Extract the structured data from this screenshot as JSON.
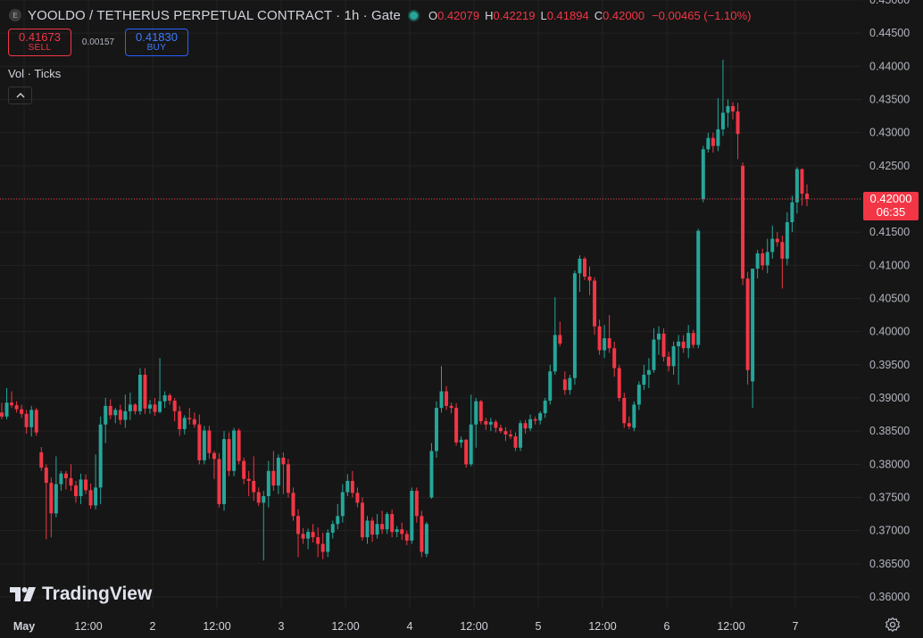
{
  "header": {
    "exchange_icon_letter": "E",
    "symbol_title": "YOOLDO / TETHERUS PERPETUAL CONTRACT · 1h · Gate",
    "open_label": "O",
    "open_value": "0.42079",
    "high_label": "H",
    "high_value": "0.42219",
    "low_label": "L",
    "low_value": "0.41894",
    "close_label": "C",
    "close_value": "0.42000",
    "change": "−0.00465 (−1.10%)"
  },
  "trade": {
    "sell_price": "0.41673",
    "sell_label": "SELL",
    "spread": "0.00157",
    "buy_price": "0.41830",
    "buy_label": "BUY"
  },
  "indicator": {
    "label": "Vol · Ticks",
    "collapse_glyph": "^"
  },
  "branding": {
    "logo_text": "TradingView"
  },
  "price_label": {
    "price": "0.42000",
    "countdown": "06:35"
  },
  "colors": {
    "up": "#26a69a",
    "down": "#f23645",
    "background": "#161616",
    "grid": "#232323"
  },
  "chart_data": {
    "type": "candlestick",
    "interval": "1h",
    "y_ticks": [
      "0.45000",
      "0.44500",
      "0.44000",
      "0.43500",
      "0.43000",
      "0.42500",
      "0.42000",
      "0.41500",
      "0.41000",
      "0.40500",
      "0.40000",
      "0.39500",
      "0.39000",
      "0.38500",
      "0.38000",
      "0.37500",
      "0.37000",
      "0.36500",
      "0.36000"
    ],
    "ylim": [
      0.3565,
      0.45
    ],
    "x_ticks": [
      "May",
      "12:00",
      "2",
      "12:00",
      "3",
      "12:00",
      "4",
      "12:00",
      "5",
      "12:00",
      "6",
      "12:00",
      "7"
    ],
    "last_price": 0.42,
    "grid": true,
    "candles": [
      {
        "o": 0.3878,
        "h": 0.3893,
        "l": 0.3868,
        "c": 0.3872
      },
      {
        "o": 0.3872,
        "h": 0.3915,
        "l": 0.3868,
        "c": 0.3893
      },
      {
        "o": 0.3893,
        "h": 0.391,
        "l": 0.3885,
        "c": 0.3889
      },
      {
        "o": 0.3889,
        "h": 0.3895,
        "l": 0.3878,
        "c": 0.3883
      },
      {
        "o": 0.3883,
        "h": 0.389,
        "l": 0.387,
        "c": 0.3876
      },
      {
        "o": 0.3876,
        "h": 0.3882,
        "l": 0.3846,
        "c": 0.3856
      },
      {
        "o": 0.3856,
        "h": 0.3888,
        "l": 0.3842,
        "c": 0.3882
      },
      {
        "o": 0.3882,
        "h": 0.3885,
        "l": 0.3843,
        "c": 0.3848
      },
      {
        "o": 0.3818,
        "h": 0.3826,
        "l": 0.379,
        "c": 0.3795
      },
      {
        "o": 0.3795,
        "h": 0.38,
        "l": 0.3687,
        "c": 0.3772
      },
      {
        "o": 0.3772,
        "h": 0.378,
        "l": 0.369,
        "c": 0.3726
      },
      {
        "o": 0.3726,
        "h": 0.3812,
        "l": 0.372,
        "c": 0.377
      },
      {
        "o": 0.377,
        "h": 0.379,
        "l": 0.376,
        "c": 0.3786
      },
      {
        "o": 0.3786,
        "h": 0.379,
        "l": 0.3762,
        "c": 0.3779
      },
      {
        "o": 0.3779,
        "h": 0.38,
        "l": 0.376,
        "c": 0.3768
      },
      {
        "o": 0.3768,
        "h": 0.3775,
        "l": 0.3742,
        "c": 0.3752
      },
      {
        "o": 0.3752,
        "h": 0.3786,
        "l": 0.374,
        "c": 0.3777
      },
      {
        "o": 0.3777,
        "h": 0.3785,
        "l": 0.3755,
        "c": 0.3761
      },
      {
        "o": 0.3761,
        "h": 0.3771,
        "l": 0.3733,
        "c": 0.3738
      },
      {
        "o": 0.3738,
        "h": 0.3815,
        "l": 0.3732,
        "c": 0.3765
      },
      {
        "o": 0.3765,
        "h": 0.3872,
        "l": 0.374,
        "c": 0.386
      },
      {
        "o": 0.386,
        "h": 0.39,
        "l": 0.3832,
        "c": 0.3888
      },
      {
        "o": 0.3888,
        "h": 0.3898,
        "l": 0.3868,
        "c": 0.3874
      },
      {
        "o": 0.3874,
        "h": 0.3885,
        "l": 0.3862,
        "c": 0.3882
      },
      {
        "o": 0.3882,
        "h": 0.389,
        "l": 0.386,
        "c": 0.3867
      },
      {
        "o": 0.3867,
        "h": 0.3905,
        "l": 0.3855,
        "c": 0.388
      },
      {
        "o": 0.388,
        "h": 0.3908,
        "l": 0.3867,
        "c": 0.389
      },
      {
        "o": 0.389,
        "h": 0.3892,
        "l": 0.3875,
        "c": 0.388
      },
      {
        "o": 0.388,
        "h": 0.3945,
        "l": 0.3875,
        "c": 0.3935
      },
      {
        "o": 0.3935,
        "h": 0.3945,
        "l": 0.3876,
        "c": 0.3884
      },
      {
        "o": 0.3884,
        "h": 0.3897,
        "l": 0.3876,
        "c": 0.389
      },
      {
        "o": 0.389,
        "h": 0.39,
        "l": 0.3873,
        "c": 0.3879
      },
      {
        "o": 0.3879,
        "h": 0.396,
        "l": 0.3877,
        "c": 0.3895
      },
      {
        "o": 0.3895,
        "h": 0.391,
        "l": 0.3885,
        "c": 0.3904
      },
      {
        "o": 0.3904,
        "h": 0.3907,
        "l": 0.389,
        "c": 0.3896
      },
      {
        "o": 0.3896,
        "h": 0.39,
        "l": 0.3865,
        "c": 0.388
      },
      {
        "o": 0.388,
        "h": 0.3888,
        "l": 0.3843,
        "c": 0.3853
      },
      {
        "o": 0.3853,
        "h": 0.3874,
        "l": 0.3845,
        "c": 0.387
      },
      {
        "o": 0.387,
        "h": 0.3885,
        "l": 0.386,
        "c": 0.3868
      },
      {
        "o": 0.3868,
        "h": 0.3878,
        "l": 0.3855,
        "c": 0.386
      },
      {
        "o": 0.386,
        "h": 0.3875,
        "l": 0.38,
        "c": 0.3806
      },
      {
        "o": 0.3806,
        "h": 0.3858,
        "l": 0.38,
        "c": 0.3851
      },
      {
        "o": 0.3851,
        "h": 0.3858,
        "l": 0.3808,
        "c": 0.3817
      },
      {
        "o": 0.3817,
        "h": 0.382,
        "l": 0.3778,
        "c": 0.3808
      },
      {
        "o": 0.3808,
        "h": 0.3817,
        "l": 0.3735,
        "c": 0.374
      },
      {
        "o": 0.374,
        "h": 0.385,
        "l": 0.373,
        "c": 0.3838
      },
      {
        "o": 0.3838,
        "h": 0.3848,
        "l": 0.3782,
        "c": 0.379
      },
      {
        "o": 0.379,
        "h": 0.3855,
        "l": 0.3782,
        "c": 0.3851
      },
      {
        "o": 0.3851,
        "h": 0.3854,
        "l": 0.38,
        "c": 0.3805
      },
      {
        "o": 0.3805,
        "h": 0.381,
        "l": 0.377,
        "c": 0.3778
      },
      {
        "o": 0.3778,
        "h": 0.379,
        "l": 0.3752,
        "c": 0.3775
      },
      {
        "o": 0.3775,
        "h": 0.3812,
        "l": 0.3745,
        "c": 0.3758
      },
      {
        "o": 0.3758,
        "h": 0.3765,
        "l": 0.3737,
        "c": 0.3742
      },
      {
        "o": 0.3742,
        "h": 0.376,
        "l": 0.3655,
        "c": 0.3752
      },
      {
        "o": 0.3752,
        "h": 0.3805,
        "l": 0.3735,
        "c": 0.379
      },
      {
        "o": 0.379,
        "h": 0.382,
        "l": 0.376,
        "c": 0.3768
      },
      {
        "o": 0.3768,
        "h": 0.3815,
        "l": 0.3755,
        "c": 0.381
      },
      {
        "o": 0.381,
        "h": 0.3818,
        "l": 0.3755,
        "c": 0.38
      },
      {
        "o": 0.38,
        "h": 0.3808,
        "l": 0.375,
        "c": 0.3757
      },
      {
        "o": 0.3757,
        "h": 0.3765,
        "l": 0.3715,
        "c": 0.3722
      },
      {
        "o": 0.3722,
        "h": 0.3732,
        "l": 0.366,
        "c": 0.3695
      },
      {
        "o": 0.3695,
        "h": 0.3704,
        "l": 0.368,
        "c": 0.3688
      },
      {
        "o": 0.3688,
        "h": 0.3703,
        "l": 0.3672,
        "c": 0.3698
      },
      {
        "o": 0.3698,
        "h": 0.371,
        "l": 0.3682,
        "c": 0.369
      },
      {
        "o": 0.369,
        "h": 0.3705,
        "l": 0.366,
        "c": 0.368
      },
      {
        "o": 0.368,
        "h": 0.3697,
        "l": 0.3657,
        "c": 0.3668
      },
      {
        "o": 0.3668,
        "h": 0.3702,
        "l": 0.366,
        "c": 0.3697
      },
      {
        "o": 0.3697,
        "h": 0.3715,
        "l": 0.3688,
        "c": 0.371
      },
      {
        "o": 0.371,
        "h": 0.374,
        "l": 0.3702,
        "c": 0.3722
      },
      {
        "o": 0.3722,
        "h": 0.377,
        "l": 0.3712,
        "c": 0.3758
      },
      {
        "o": 0.3758,
        "h": 0.3785,
        "l": 0.3752,
        "c": 0.3775
      },
      {
        "o": 0.3775,
        "h": 0.379,
        "l": 0.375,
        "c": 0.3757
      },
      {
        "o": 0.3757,
        "h": 0.3765,
        "l": 0.3735,
        "c": 0.3742
      },
      {
        "o": 0.3742,
        "h": 0.375,
        "l": 0.3685,
        "c": 0.369
      },
      {
        "o": 0.369,
        "h": 0.3722,
        "l": 0.368,
        "c": 0.3715
      },
      {
        "o": 0.3715,
        "h": 0.372,
        "l": 0.3683,
        "c": 0.3694
      },
      {
        "o": 0.3694,
        "h": 0.3725,
        "l": 0.3688,
        "c": 0.371
      },
      {
        "o": 0.371,
        "h": 0.373,
        "l": 0.3695,
        "c": 0.3702
      },
      {
        "o": 0.3702,
        "h": 0.3728,
        "l": 0.3695,
        "c": 0.3725
      },
      {
        "o": 0.3725,
        "h": 0.3732,
        "l": 0.369,
        "c": 0.3698
      },
      {
        "o": 0.3698,
        "h": 0.3707,
        "l": 0.369,
        "c": 0.3702
      },
      {
        "o": 0.3702,
        "h": 0.3712,
        "l": 0.3686,
        "c": 0.3695
      },
      {
        "o": 0.3695,
        "h": 0.37,
        "l": 0.3678,
        "c": 0.3685
      },
      {
        "o": 0.3685,
        "h": 0.3765,
        "l": 0.368,
        "c": 0.376
      },
      {
        "o": 0.376,
        "h": 0.3765,
        "l": 0.3712,
        "c": 0.3722
      },
      {
        "o": 0.3722,
        "h": 0.373,
        "l": 0.366,
        "c": 0.3668
      },
      {
        "o": 0.3665,
        "h": 0.3713,
        "l": 0.366,
        "c": 0.371
      },
      {
        "o": 0.375,
        "h": 0.3832,
        "l": 0.3748,
        "c": 0.382
      },
      {
        "o": 0.382,
        "h": 0.3895,
        "l": 0.381,
        "c": 0.3885
      },
      {
        "o": 0.3885,
        "h": 0.3948,
        "l": 0.3878,
        "c": 0.391
      },
      {
        "o": 0.391,
        "h": 0.3918,
        "l": 0.3882,
        "c": 0.3888
      },
      {
        "o": 0.3888,
        "h": 0.3893,
        "l": 0.3877,
        "c": 0.3885
      },
      {
        "o": 0.3885,
        "h": 0.3892,
        "l": 0.3828,
        "c": 0.3833
      },
      {
        "o": 0.3833,
        "h": 0.3842,
        "l": 0.3825,
        "c": 0.3837
      },
      {
        "o": 0.3837,
        "h": 0.3838,
        "l": 0.3795,
        "c": 0.38
      },
      {
        "o": 0.38,
        "h": 0.3905,
        "l": 0.3797,
        "c": 0.386
      },
      {
        "o": 0.386,
        "h": 0.39,
        "l": 0.3825,
        "c": 0.3895
      },
      {
        "o": 0.3895,
        "h": 0.3897,
        "l": 0.386,
        "c": 0.3865
      },
      {
        "o": 0.3865,
        "h": 0.387,
        "l": 0.3852,
        "c": 0.386
      },
      {
        "o": 0.386,
        "h": 0.387,
        "l": 0.385,
        "c": 0.3864
      },
      {
        "o": 0.3864,
        "h": 0.3867,
        "l": 0.3848,
        "c": 0.3855
      },
      {
        "o": 0.3855,
        "h": 0.386,
        "l": 0.3847,
        "c": 0.385
      },
      {
        "o": 0.385,
        "h": 0.3856,
        "l": 0.3835,
        "c": 0.3845
      },
      {
        "o": 0.3845,
        "h": 0.3852,
        "l": 0.3838,
        "c": 0.3842
      },
      {
        "o": 0.3842,
        "h": 0.3848,
        "l": 0.382,
        "c": 0.3825
      },
      {
        "o": 0.3825,
        "h": 0.3866,
        "l": 0.382,
        "c": 0.3862
      },
      {
        "o": 0.3862,
        "h": 0.3867,
        "l": 0.3846,
        "c": 0.3854
      },
      {
        "o": 0.3854,
        "h": 0.3875,
        "l": 0.385,
        "c": 0.3868
      },
      {
        "o": 0.3868,
        "h": 0.3872,
        "l": 0.386,
        "c": 0.3866
      },
      {
        "o": 0.3866,
        "h": 0.388,
        "l": 0.386,
        "c": 0.3877
      },
      {
        "o": 0.3877,
        "h": 0.39,
        "l": 0.387,
        "c": 0.3896
      },
      {
        "o": 0.3896,
        "h": 0.395,
        "l": 0.389,
        "c": 0.394
      },
      {
        "o": 0.394,
        "h": 0.4052,
        "l": 0.3935,
        "c": 0.3995
      },
      {
        "o": 0.3995,
        "h": 0.4015,
        "l": 0.3978,
        "c": 0.3982
      },
      {
        "o": 0.3928,
        "h": 0.394,
        "l": 0.3905,
        "c": 0.3912
      },
      {
        "o": 0.3912,
        "h": 0.3935,
        "l": 0.3905,
        "c": 0.393
      },
      {
        "o": 0.393,
        "h": 0.4092,
        "l": 0.392,
        "c": 0.4088
      },
      {
        "o": 0.4088,
        "h": 0.4115,
        "l": 0.406,
        "c": 0.411
      },
      {
        "o": 0.411,
        "h": 0.4113,
        "l": 0.4078,
        "c": 0.4083
      },
      {
        "o": 0.4083,
        "h": 0.4098,
        "l": 0.4055,
        "c": 0.4077
      },
      {
        "o": 0.4077,
        "h": 0.4082,
        "l": 0.3995,
        "c": 0.4008
      },
      {
        "o": 0.4008,
        "h": 0.4018,
        "l": 0.3965,
        "c": 0.3972
      },
      {
        "o": 0.3972,
        "h": 0.401,
        "l": 0.396,
        "c": 0.399
      },
      {
        "o": 0.399,
        "h": 0.4025,
        "l": 0.3968,
        "c": 0.3975
      },
      {
        "o": 0.3975,
        "h": 0.3985,
        "l": 0.3932,
        "c": 0.3945
      },
      {
        "o": 0.3945,
        "h": 0.395,
        "l": 0.3895,
        "c": 0.39
      },
      {
        "o": 0.39,
        "h": 0.3908,
        "l": 0.3855,
        "c": 0.3862
      },
      {
        "o": 0.3862,
        "h": 0.3872,
        "l": 0.3853,
        "c": 0.3857
      },
      {
        "o": 0.3855,
        "h": 0.3895,
        "l": 0.385,
        "c": 0.389
      },
      {
        "o": 0.389,
        "h": 0.3925,
        "l": 0.3882,
        "c": 0.392
      },
      {
        "o": 0.392,
        "h": 0.395,
        "l": 0.3912,
        "c": 0.3935
      },
      {
        "o": 0.3935,
        "h": 0.396,
        "l": 0.3915,
        "c": 0.3942
      },
      {
        "o": 0.3942,
        "h": 0.4005,
        "l": 0.3938,
        "c": 0.3988
      },
      {
        "o": 0.3988,
        "h": 0.4008,
        "l": 0.3965,
        "c": 0.3997
      },
      {
        "o": 0.3997,
        "h": 0.4005,
        "l": 0.3955,
        "c": 0.3962
      },
      {
        "o": 0.3962,
        "h": 0.397,
        "l": 0.394,
        "c": 0.3948
      },
      {
        "o": 0.3948,
        "h": 0.3985,
        "l": 0.3935,
        "c": 0.3978
      },
      {
        "o": 0.3978,
        "h": 0.3995,
        "l": 0.392,
        "c": 0.3985
      },
      {
        "o": 0.3985,
        "h": 0.3995,
        "l": 0.3968,
        "c": 0.3975
      },
      {
        "o": 0.3975,
        "h": 0.401,
        "l": 0.396,
        "c": 0.3998
      },
      {
        "o": 0.3998,
        "h": 0.4003,
        "l": 0.3975,
        "c": 0.398
      },
      {
        "o": 0.398,
        "h": 0.4155,
        "l": 0.3975,
        "c": 0.4152
      },
      {
        "o": 0.42,
        "h": 0.428,
        "l": 0.4195,
        "c": 0.4275
      },
      {
        "o": 0.4275,
        "h": 0.43,
        "l": 0.427,
        "c": 0.4292
      },
      {
        "o": 0.4292,
        "h": 0.43,
        "l": 0.427,
        "c": 0.428
      },
      {
        "o": 0.428,
        "h": 0.4352,
        "l": 0.4272,
        "c": 0.4305
      },
      {
        "o": 0.4305,
        "h": 0.441,
        "l": 0.4295,
        "c": 0.433
      },
      {
        "o": 0.433,
        "h": 0.435,
        "l": 0.4308,
        "c": 0.434
      },
      {
        "o": 0.434,
        "h": 0.4346,
        "l": 0.432,
        "c": 0.4332
      },
      {
        "o": 0.4332,
        "h": 0.4345,
        "l": 0.426,
        "c": 0.4298
      },
      {
        "o": 0.425,
        "h": 0.4255,
        "l": 0.407,
        "c": 0.408
      },
      {
        "o": 0.408,
        "h": 0.409,
        "l": 0.392,
        "c": 0.3942
      },
      {
        "o": 0.3925,
        "h": 0.404,
        "l": 0.3885,
        "c": 0.4095
      },
      {
        "o": 0.4095,
        "h": 0.4123,
        "l": 0.408,
        "c": 0.4118
      },
      {
        "o": 0.4118,
        "h": 0.4125,
        "l": 0.4093,
        "c": 0.41
      },
      {
        "o": 0.41,
        "h": 0.414,
        "l": 0.4088,
        "c": 0.412
      },
      {
        "o": 0.412,
        "h": 0.416,
        "l": 0.411,
        "c": 0.414
      },
      {
        "o": 0.414,
        "h": 0.415,
        "l": 0.4128,
        "c": 0.4135
      },
      {
        "o": 0.4135,
        "h": 0.4145,
        "l": 0.4065,
        "c": 0.411
      },
      {
        "o": 0.411,
        "h": 0.418,
        "l": 0.41,
        "c": 0.4165
      },
      {
        "o": 0.4165,
        "h": 0.4205,
        "l": 0.415,
        "c": 0.4195
      },
      {
        "o": 0.4195,
        "h": 0.4248,
        "l": 0.4178,
        "c": 0.4245
      },
      {
        "o": 0.4245,
        "h": 0.4246,
        "l": 0.419,
        "c": 0.4208
      },
      {
        "o": 0.4208,
        "h": 0.4222,
        "l": 0.4189,
        "c": 0.42
      }
    ]
  }
}
